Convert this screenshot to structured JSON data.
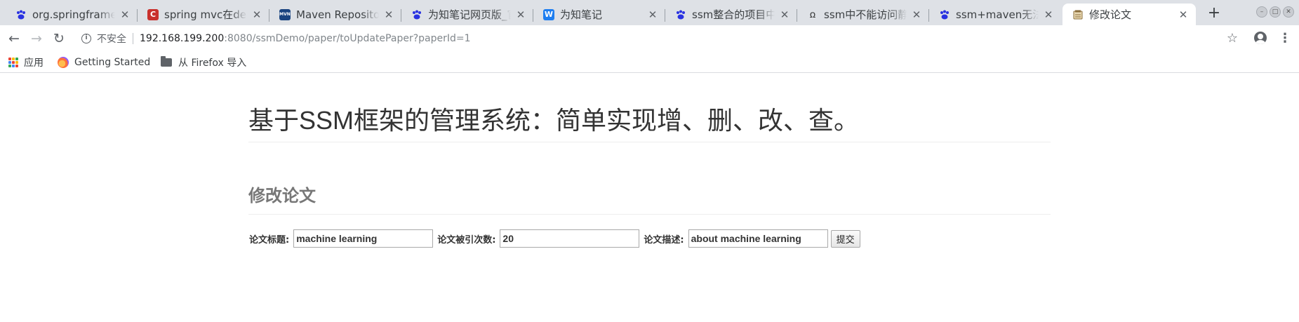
{
  "browser": {
    "tabs": [
      {
        "title": "org.springframework",
        "icon": "baidu-paw-icon",
        "active": false
      },
      {
        "title": "spring mvc在debug",
        "icon": "csdn-icon",
        "active": false
      },
      {
        "title": "Maven Repository: ",
        "icon": "mvn-icon",
        "active": false
      },
      {
        "title": "为知笔记网页版_官方",
        "icon": "baidu-paw-icon",
        "active": false
      },
      {
        "title": "为知笔记",
        "icon": "wiz-icon",
        "active": false
      },
      {
        "title": "ssm整合的项目中静态",
        "icon": "baidu-paw-icon",
        "active": false
      },
      {
        "title": "ssm中不能访问静态",
        "icon": "omega-icon",
        "active": false
      },
      {
        "title": "ssm+maven无法访问",
        "icon": "baidu-paw-icon",
        "active": false
      },
      {
        "title": "修改论文",
        "icon": "page-icon",
        "active": true
      }
    ],
    "new_tab_label": "+",
    "address": {
      "security_label": "不安全",
      "host": "192.168.199.200",
      "rest": ":8080/ssmDemo/paper/toUpdatePaper?paperId=1"
    },
    "bookmarks": [
      {
        "label": "应用",
        "icon": "apps-grid-icon"
      },
      {
        "label": "Getting Started",
        "icon": "firefox-icon"
      },
      {
        "label": "从 Firefox 导入",
        "icon": "folder-icon"
      }
    ],
    "colors": {
      "tabstrip": "#dee1e6",
      "accent_baidu": "#2932e1",
      "accent_csdn": "#c9302c",
      "accent_wiz": "#1e7ef0"
    }
  },
  "page": {
    "title": "基于SSM框架的管理系统：简单实现增、删、改、查。",
    "subtitle": "修改论文",
    "form": {
      "title_label": "论文标题:",
      "title_value": "machine learning",
      "citation_label": "论文被引次数:",
      "citation_value": "20",
      "desc_label": "论文描述:",
      "desc_value": "about machine learning",
      "submit_label": "提交"
    }
  }
}
